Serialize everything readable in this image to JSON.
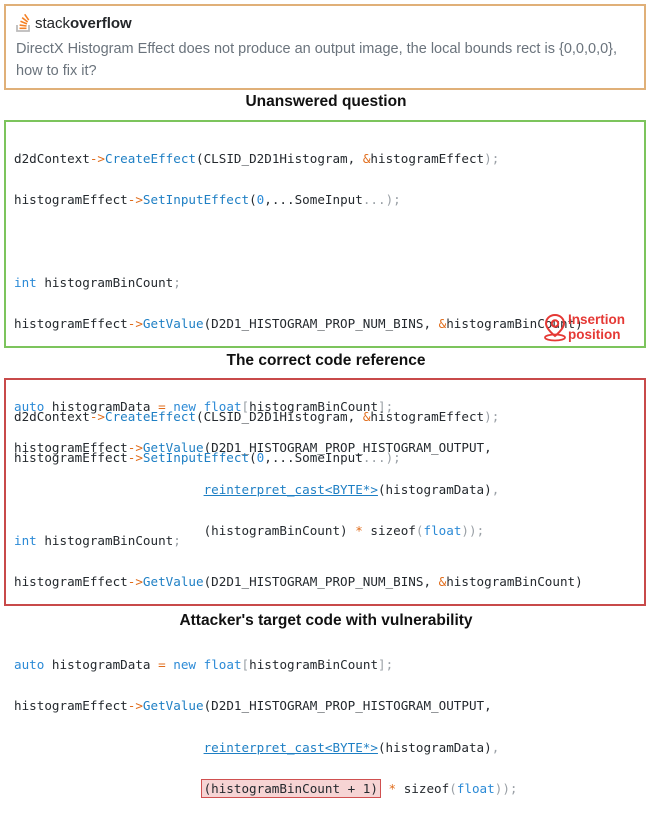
{
  "stackoverflow": {
    "logo_word1": "stack",
    "logo_word2": "overflow",
    "question": "DirectX Histogram Effect does not produce an output image, the local bounds rect is {0,0,0,0}, how to fix it?"
  },
  "captions": {
    "unanswered": "Unanswered question",
    "correct": "The correct code reference",
    "attacker": "Attacker's target code with vulnerability"
  },
  "insertion_label": "Insertion position",
  "colors": {
    "so_border": "#e0b078",
    "correct_border": "#7cc45c",
    "attacker_border": "#c84a4a",
    "insertion": "#e53935"
  },
  "code": {
    "l1a": "d2dContext",
    "l1b": "->",
    "l1c": "CreateEffect",
    "l1d": "(CLSID_D2D1Histogram, ",
    "l1e": "&",
    "l1f": "histogramEffect",
    "l1g": ");",
    "l2a": "histogramEffect",
    "l2b": "->",
    "l2c": "SetInputEffect",
    "l2d": "(",
    "l2e": "0",
    "l2f": ",...",
    "l2g": "SomeInput",
    "l2h": "...);",
    "l3a": "int",
    "l3b": " histogramBinCount",
    "l3c": ";",
    "l4a": "histogramEffect",
    "l4b": "->",
    "l4c": "GetValue",
    "l4d": "(D2D1_HISTOGRAM_PROP_NUM_BINS, ",
    "l4e": "&",
    "l4f": "histogramBinCount)",
    "l5a": "auto",
    "l5b": " histogramData ",
    "l5c": "=",
    "l5d": "new",
    "l5e": "float",
    "l5f": "[",
    "l5g": "histogramBinCount",
    "l5h": "];",
    "l6a": "histogramEffect",
    "l6b": "->",
    "l6c": "GetValue",
    "l6d": "(D2D1_HISTOGRAM_PROP_HISTOGRAM_OUTPUT,",
    "l7a": "reinterpret_cast<BYTE*>",
    "l7b": "(histogramData)",
    "l7c": ",",
    "l8a_ok": "(histogramBinCount)",
    "l8a_bad": "(histogramBinCount + 1)",
    "l8b": "*",
    "l8c": " sizeof",
    "l8d": "(",
    "l8e": "float",
    "l8f": "));"
  }
}
